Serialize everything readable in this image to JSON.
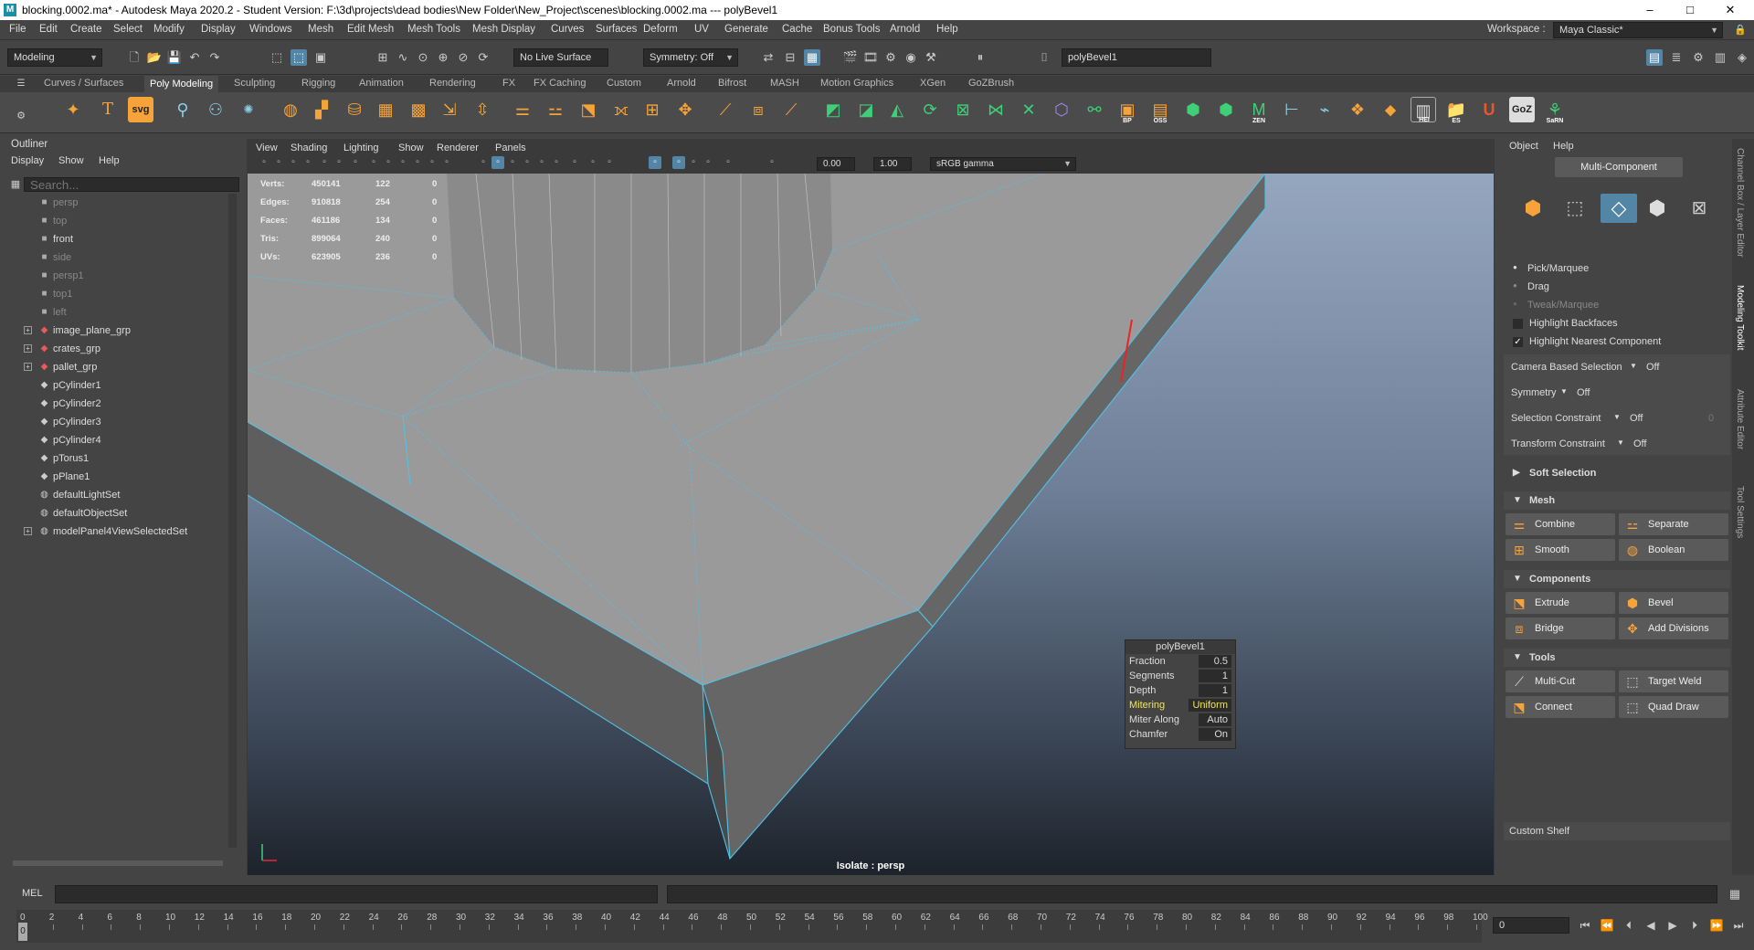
{
  "window": {
    "title": "blocking.0002.ma* - Autodesk Maya 2020.2 - Student Version: F:\\3d\\projects\\dead bodies\\New Folder\\New_Project\\scenes\\blocking.0002.ma   ---   polyBevel1",
    "minimize": "–",
    "maximize": "□",
    "close": "✕",
    "logo": "M"
  },
  "menu": [
    "File",
    "Edit",
    "Create",
    "Select",
    "Modify",
    "Display",
    "Windows",
    "Mesh",
    "Edit Mesh",
    "Mesh Tools",
    "Mesh Display",
    "Curves",
    "Surfaces",
    "Deform",
    "UV",
    "Generate",
    "Cache",
    "Bonus Tools",
    "Arnold",
    "Help"
  ],
  "workspace": {
    "label": "Workspace :",
    "value": "Maya Classic*"
  },
  "statusline": {
    "mode": "Modeling",
    "live_surface": "No Live Surface",
    "symmetry": "Symmetry: Off",
    "input_field": "polyBevel1"
  },
  "shelf_tabs": [
    "Curves / Surfaces",
    "Poly Modeling",
    "Sculpting",
    "Rigging",
    "Animation",
    "Rendering",
    "FX",
    "FX Caching",
    "Custom",
    "Arnold",
    "Bifrost",
    "MASH",
    "Motion Graphics",
    "XGen",
    "GoZBrush"
  ],
  "shelf_active": "Poly Modeling",
  "shelf_labels": {
    "svg": "svg",
    "bp": "BP",
    "oss": "OSS",
    "zen": "ZEN",
    "hei": "HEI",
    "es": "ES",
    "goz": "GoZ",
    "sarn": "SaRN"
  },
  "outliner": {
    "title": "Outliner",
    "menus": [
      "Display",
      "Show",
      "Help"
    ],
    "search_placeholder": "Search...",
    "items": [
      {
        "label": "persp",
        "dim": true,
        "icon": "camera-icon",
        "expand": false
      },
      {
        "label": "top",
        "dim": true,
        "icon": "camera-icon",
        "expand": false
      },
      {
        "label": "front",
        "dim": false,
        "icon": "camera-icon",
        "expand": false
      },
      {
        "label": "side",
        "dim": true,
        "icon": "camera-icon",
        "expand": false
      },
      {
        "label": "persp1",
        "dim": true,
        "icon": "camera-icon",
        "expand": false
      },
      {
        "label": "top1",
        "dim": true,
        "icon": "camera-icon",
        "expand": false
      },
      {
        "label": "left",
        "dim": true,
        "icon": "camera-icon",
        "expand": false
      },
      {
        "label": "image_plane_grp",
        "dim": false,
        "icon": "group-icon",
        "expand": true
      },
      {
        "label": "crates_grp",
        "dim": false,
        "icon": "group-icon",
        "expand": true
      },
      {
        "label": "pallet_grp",
        "dim": false,
        "icon": "group-icon",
        "expand": true
      },
      {
        "label": "pCylinder1",
        "dim": false,
        "icon": "mesh-icon",
        "expand": false
      },
      {
        "label": "pCylinder2",
        "dim": false,
        "icon": "mesh-icon",
        "expand": false
      },
      {
        "label": "pCylinder3",
        "dim": false,
        "icon": "mesh-icon",
        "expand": false
      },
      {
        "label": "pCylinder4",
        "dim": false,
        "icon": "mesh-icon",
        "expand": false
      },
      {
        "label": "pTorus1",
        "dim": false,
        "icon": "mesh-icon",
        "expand": false
      },
      {
        "label": "pPlane1",
        "dim": false,
        "icon": "mesh-icon",
        "expand": false
      },
      {
        "label": "defaultLightSet",
        "dim": false,
        "icon": "set-icon",
        "expand": false
      },
      {
        "label": "defaultObjectSet",
        "dim": false,
        "icon": "set-icon",
        "expand": false
      },
      {
        "label": "modelPanel4ViewSelectedSet",
        "dim": false,
        "icon": "set-icon",
        "expand": true
      }
    ]
  },
  "viewport": {
    "menus": [
      "View",
      "Shading",
      "Lighting",
      "Show",
      "Renderer",
      "Panels"
    ],
    "exposure": "0.00",
    "gamma": "1.00",
    "color_space": "sRGB gamma",
    "caption": "Isolate : persp",
    "hud": [
      {
        "label": "Verts:",
        "a": "450141",
        "b": "122",
        "c": "0"
      },
      {
        "label": "Edges:",
        "a": "910818",
        "b": "254",
        "c": "0"
      },
      {
        "label": "Faces:",
        "a": "461186",
        "b": "134",
        "c": "0"
      },
      {
        "label": "Tris:",
        "a": "899064",
        "b": "240",
        "c": "0"
      },
      {
        "label": "UVs:",
        "a": "623905",
        "b": "236",
        "c": "0"
      }
    ]
  },
  "bevel": {
    "title": "polyBevel1",
    "rows": [
      {
        "label": "Fraction",
        "value": "0.5"
      },
      {
        "label": "Segments",
        "value": "1"
      },
      {
        "label": "Depth",
        "value": "1"
      },
      {
        "label": "Mitering",
        "value": "Uniform"
      },
      {
        "label": "Miter Along",
        "value": "Auto"
      },
      {
        "label": "Chamfer",
        "value": "On"
      }
    ]
  },
  "toolkit": {
    "menus": [
      "Object",
      "Help"
    ],
    "mode": "Multi-Component",
    "pick": "Pick/Marquee",
    "drag": "Drag",
    "tweak": "Tweak/Marquee",
    "highlight_backfaces": "Highlight Backfaces",
    "highlight_nearest": "Highlight Nearest Component",
    "camera_sel": {
      "label": "Camera Based Selection",
      "value": "Off"
    },
    "symmetry": {
      "label": "Symmetry",
      "value": "Off"
    },
    "sel_constraint": {
      "label": "Selection Constraint",
      "value": "Off",
      "extra": "0"
    },
    "xform_constraint": {
      "label": "Transform Constraint",
      "value": "Off"
    },
    "soft_selection": "Soft Selection",
    "sections": {
      "mesh": "Mesh",
      "components": "Components",
      "tools": "Tools"
    },
    "mesh_buttons": [
      "Combine",
      "Separate",
      "Smooth",
      "Boolean"
    ],
    "component_buttons": [
      "Extrude",
      "Bevel",
      "Bridge",
      "Add Divisions"
    ],
    "tool_buttons": [
      "Multi-Cut",
      "Target Weld",
      "Connect",
      "Quad Draw"
    ],
    "custom_shelf": "Custom Shelf"
  },
  "right_tabs": [
    "Channel Box / Layer Editor",
    "Modeling Toolkit",
    "Attribute Editor",
    "Tool Settings"
  ],
  "cmd": {
    "label": "MEL"
  },
  "timeline": {
    "ticks": [
      "0",
      "2",
      "4",
      "6",
      "8",
      "10",
      "12",
      "14",
      "16",
      "18",
      "20",
      "22",
      "24",
      "26",
      "28",
      "30",
      "32",
      "34",
      "36",
      "38",
      "40",
      "42",
      "44",
      "46",
      "48",
      "50",
      "52",
      "54",
      "56",
      "58",
      "60",
      "62",
      "64",
      "66",
      "68",
      "70",
      "72",
      "74",
      "76",
      "78",
      "80",
      "82",
      "84",
      "86",
      "88",
      "90",
      "92",
      "94",
      "96",
      "98",
      "100"
    ],
    "current": "0",
    "current_field": "0"
  }
}
